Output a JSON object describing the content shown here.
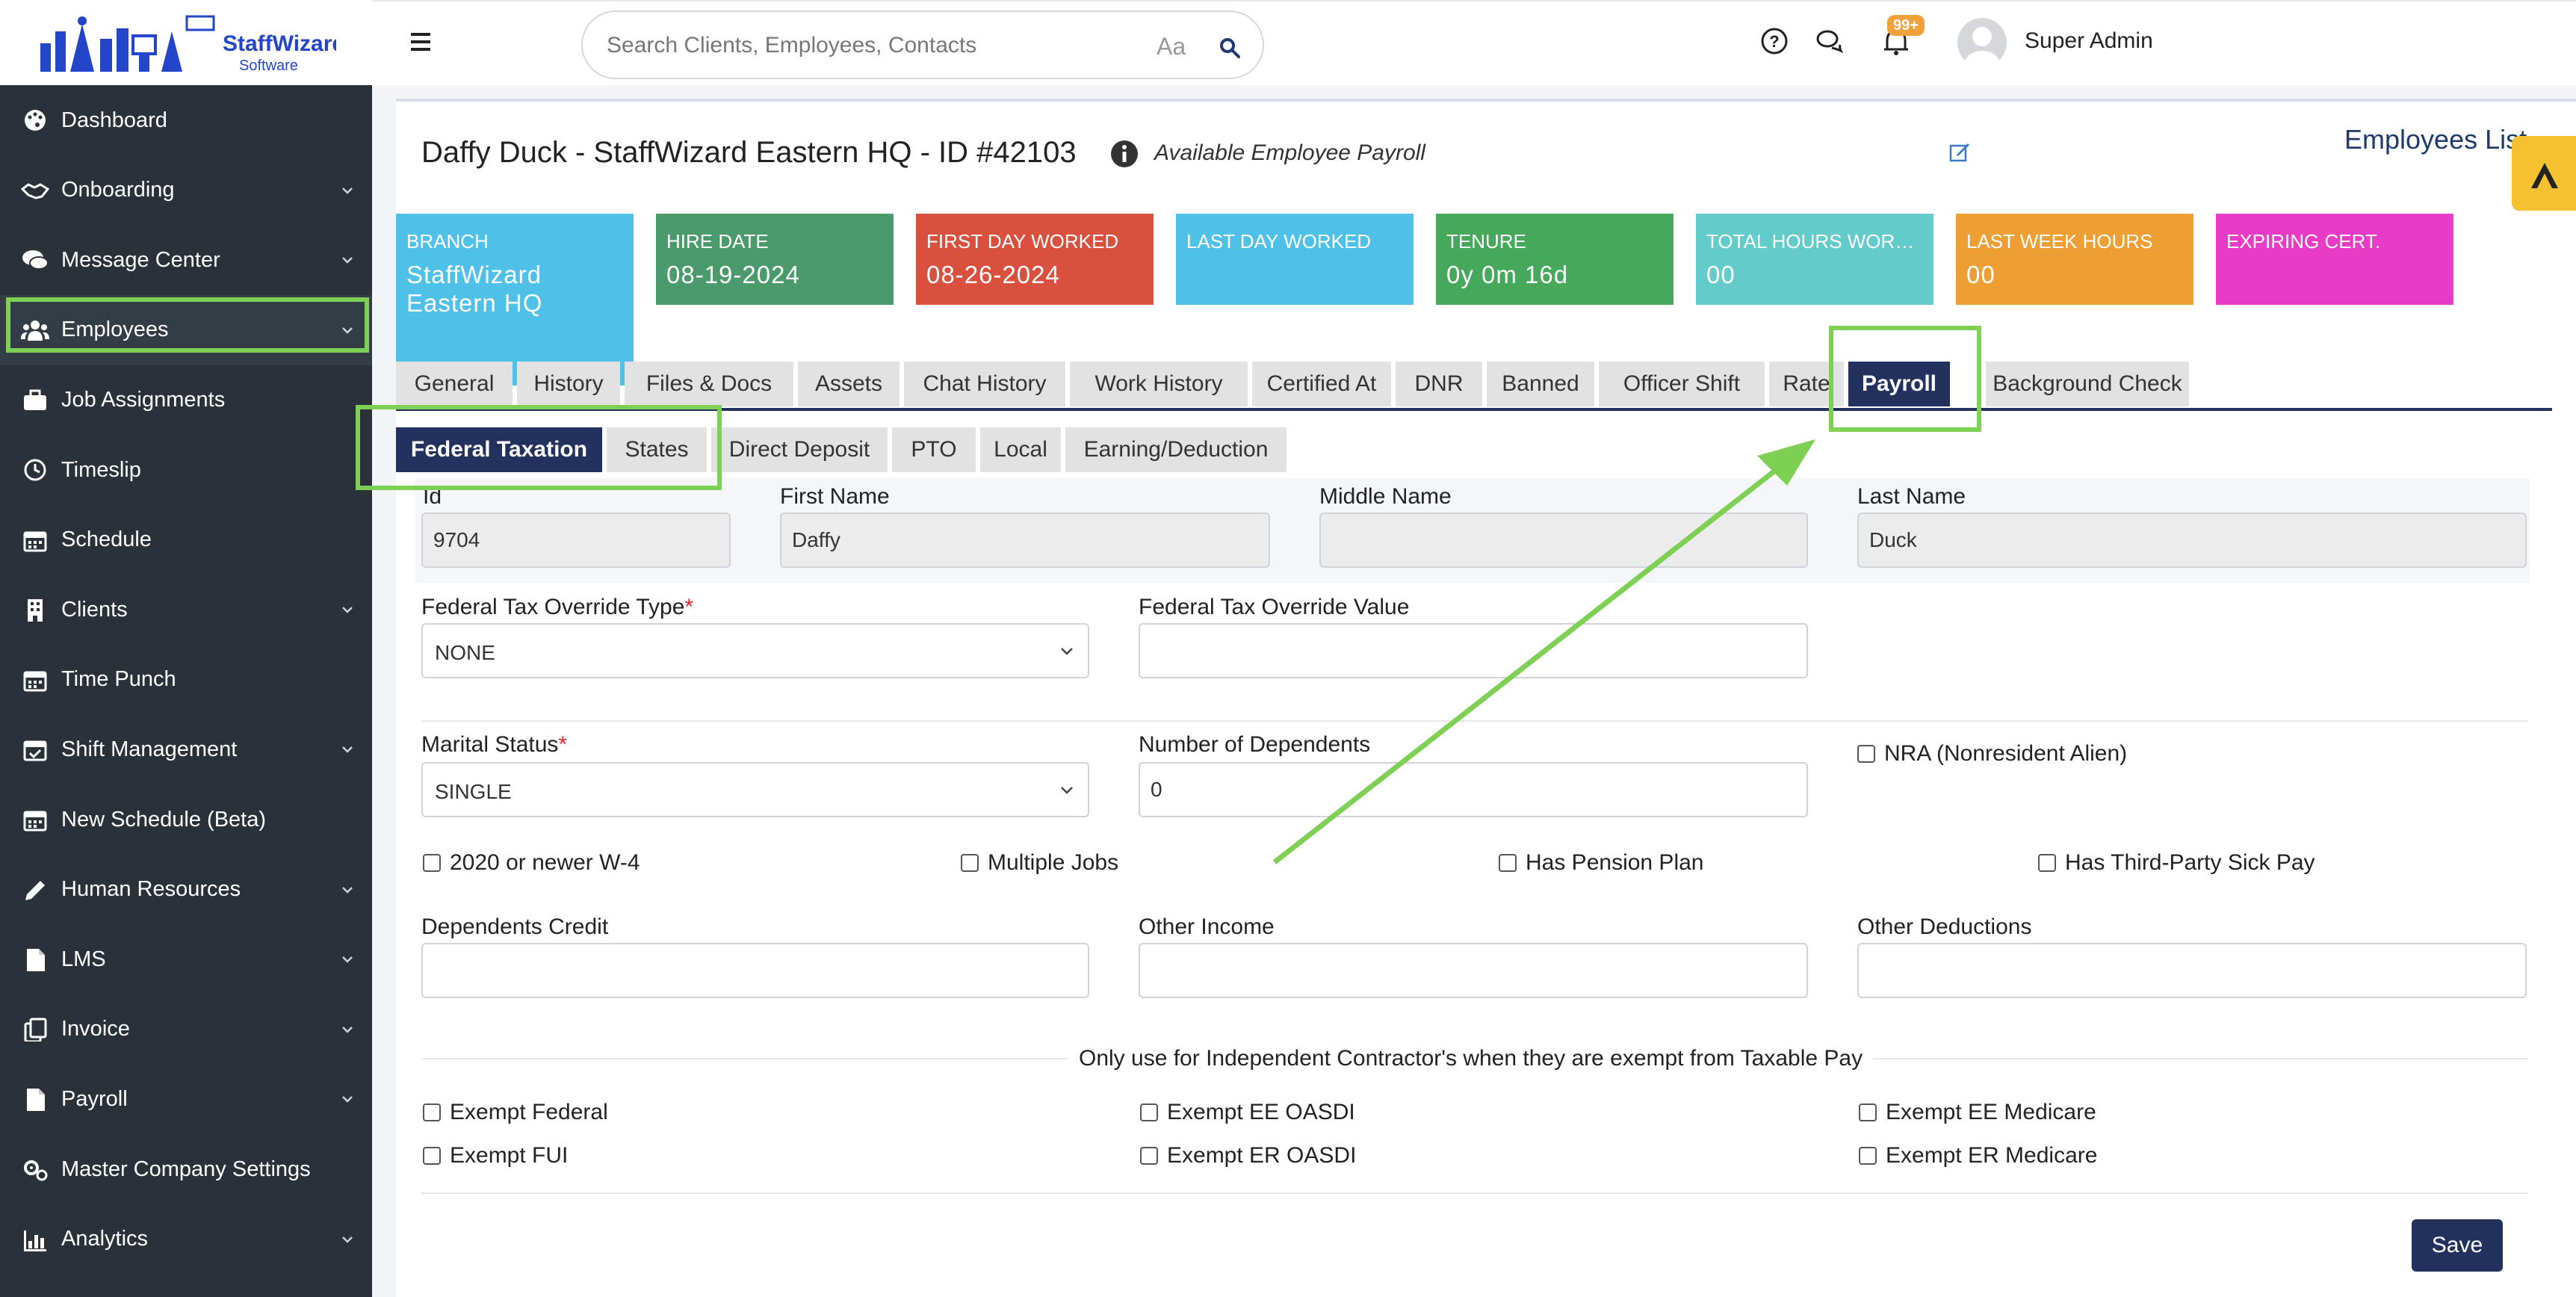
{
  "app": {
    "brand_colors": {
      "sidebar": "#2b3138",
      "primary": "#23315f",
      "highlight": "#7ed054"
    }
  },
  "logo": {
    "name": "StaffWizard",
    "tagline": "Software"
  },
  "sidebar": {
    "items": [
      {
        "label": "Dashboard",
        "icon": "palette-icon",
        "chevron": false
      },
      {
        "label": "Onboarding",
        "icon": "handshake-icon",
        "chevron": true
      },
      {
        "label": "Message Center",
        "icon": "chat-bubbles-icon",
        "chevron": true
      },
      {
        "label": "Employees",
        "icon": "users-icon",
        "chevron": true
      },
      {
        "label": "Job Assignments",
        "icon": "briefcase-icon",
        "chevron": false
      },
      {
        "label": "Timeslip",
        "icon": "clock-icon",
        "chevron": false
      },
      {
        "label": "Schedule",
        "icon": "calendar-icon",
        "chevron": false
      },
      {
        "label": "Clients",
        "icon": "building-icon",
        "chevron": true
      },
      {
        "label": "Time Punch",
        "icon": "calendar-icon",
        "chevron": false
      },
      {
        "label": "Shift Management",
        "icon": "calendar-check-icon",
        "chevron": true
      },
      {
        "label": "New Schedule (Beta)",
        "icon": "calendar-icon",
        "chevron": false
      },
      {
        "label": "Human Resources",
        "icon": "pen-icon",
        "chevron": true
      },
      {
        "label": "LMS",
        "icon": "document-icon",
        "chevron": true
      },
      {
        "label": "Invoice",
        "icon": "copy-icon",
        "chevron": true
      },
      {
        "label": "Payroll",
        "icon": "document-icon",
        "chevron": true
      },
      {
        "label": "Master Company Settings",
        "icon": "gears-icon",
        "chevron": false
      },
      {
        "label": "Analytics",
        "icon": "bar-chart-icon",
        "chevron": true
      }
    ]
  },
  "topbar": {
    "search_placeholder": "Search Clients, Employees, Contacts",
    "case_toggle": "Aa",
    "notifications_badge": "99+",
    "user_name": "Super Admin"
  },
  "header": {
    "title": "Daffy Duck - StaffWizard Eastern HQ - ID #42103",
    "subtitle": "Available Employee Payroll",
    "employees_list_link": "Employees List"
  },
  "stats": [
    {
      "label": "BRANCH",
      "value": "StaffWizard Eastern HQ",
      "color": "#4fc1e9"
    },
    {
      "label": "HIRE DATE",
      "value": "08-19-2024",
      "color": "#4a9a6b"
    },
    {
      "label": "FIRST DAY WORKED",
      "value": "08-26-2024",
      "color": "#d9503f"
    },
    {
      "label": "LAST DAY WORKED",
      "value": "",
      "color": "#4fc1e9"
    },
    {
      "label": "TENURE",
      "value": "0y 0m 16d",
      "color": "#45a85a"
    },
    {
      "label": "TOTAL HOURS WORK...",
      "value": "00",
      "color": "#63cbc9"
    },
    {
      "label": "LAST WEEK HOURS",
      "value": "00",
      "color": "#ee9f33"
    },
    {
      "label": "EXPIRING CERT.",
      "value": "",
      "color": "#e83bc7"
    }
  ],
  "tabs": [
    "General",
    "History",
    "Files & Docs",
    "Assets",
    "Chat History",
    "Work History",
    "Certified At",
    "DNR",
    "Banned",
    "Officer Shift",
    "Rate",
    "Payroll",
    "Background Check"
  ],
  "active_tab": "Payroll",
  "subtabs": [
    "Federal Taxation",
    "States",
    "Direct Deposit",
    "PTO",
    "Local",
    "Earning/Deduction"
  ],
  "active_subtab": "Federal Taxation",
  "form": {
    "labels": {
      "id": "Id",
      "first_name": "First Name",
      "middle_name": "Middle Name",
      "last_name": "Last Name",
      "override_type": "Federal Tax Override Type",
      "override_value": "Federal Tax Override Value",
      "marital_status": "Marital Status",
      "dependents": "Number of Dependents",
      "dependents_credit": "Dependents Credit",
      "other_income": "Other Income",
      "other_deductions": "Other Deductions",
      "required_mark": "*"
    },
    "values": {
      "id": "9704",
      "first_name": "Daffy",
      "middle_name": "",
      "last_name": "Duck",
      "override_type": "NONE",
      "override_value": "",
      "marital_status": "SINGLE",
      "dependents": "0",
      "dependents_credit": "",
      "other_income": "",
      "other_deductions": ""
    },
    "checkboxes": {
      "nra": "NRA (Nonresident Alien)",
      "w4_2020": "2020 or newer W-4",
      "multiple_jobs": "Multiple Jobs",
      "pension": "Has Pension Plan",
      "sick_pay": "Has Third-Party Sick Pay",
      "exempt_federal": "Exempt Federal",
      "exempt_fui": "Exempt FUI",
      "exempt_ee_oasdi": "Exempt EE OASDI",
      "exempt_er_oasdi": "Exempt ER OASDI",
      "exempt_ee_medicare": "Exempt EE Medicare",
      "exempt_er_medicare": "Exempt ER Medicare"
    },
    "contractor_note": "Only use for Independent Contractor's when they are exempt from Taxable Pay",
    "save_label": "Save"
  }
}
